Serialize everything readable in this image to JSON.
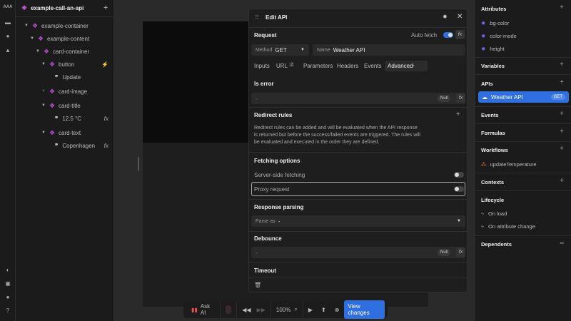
{
  "left_panel": {
    "title": "example-call-an-api",
    "tree": [
      {
        "label": "example-container",
        "type": "element"
      },
      {
        "label": "example-content",
        "type": "element"
      },
      {
        "label": "card-container",
        "type": "element"
      },
      {
        "label": "button",
        "type": "element"
      },
      {
        "label": "Update",
        "type": "text"
      },
      {
        "label": "card-image",
        "type": "element"
      },
      {
        "label": "card-title",
        "type": "element"
      },
      {
        "label": "12.5 °C",
        "type": "text"
      },
      {
        "label": "card-text",
        "type": "element"
      },
      {
        "label": "Copenhagen",
        "type": "text"
      }
    ],
    "fx": "fx"
  },
  "modal": {
    "title": "Edit API",
    "request": "Request",
    "auto_fetch": "Auto fetch",
    "auto_fetch_on": true,
    "method_label": "Method",
    "method": "GET",
    "name_label": "Name",
    "name": "Weather API",
    "tabs": [
      "Inputs",
      "URL",
      "Parameters",
      "Headers",
      "Events",
      "Advanced"
    ],
    "url_count": "2",
    "is_error": "Is error",
    "null": "Null",
    "dash": "-",
    "redirect_rules": "Redirect rules",
    "redirect_text": "Redirect rules can be added and will be evaluated when the API response is returned but before the success/failed events are triggered. The rules will be evaluated and executed in the order they are defined.",
    "fetching_options": "Fetching options",
    "server_side": "Server-side fetching",
    "proxy": "Proxy request",
    "response_parsing": "Response parsing",
    "parse_as_label": "Parse as",
    "parse_as": "-",
    "debounce": "Debounce",
    "timeout": "Timeout"
  },
  "right_panel": {
    "attributes": "Attributes",
    "attr_items": [
      "bg-color",
      "color-mode",
      "height"
    ],
    "variables": "Variables",
    "apis": "APIs",
    "api_item": "Weather API",
    "api_method": "GET",
    "events": "Events",
    "formulas": "Formulas",
    "workflows": "Workflows",
    "workflow_item": "updateTemperature",
    "contexts": "Contexts",
    "lifecycle": "Lifecycle",
    "lifecycle_items": [
      "On load",
      "On attribute change"
    ],
    "dependents": "Dependents"
  },
  "bottom_bar": {
    "ask_ai": "Ask AI",
    "zoom": "100%",
    "view_changes": "View changes"
  },
  "colors": {
    "accent": "#2f6fe0",
    "element": "#c04fd8"
  }
}
